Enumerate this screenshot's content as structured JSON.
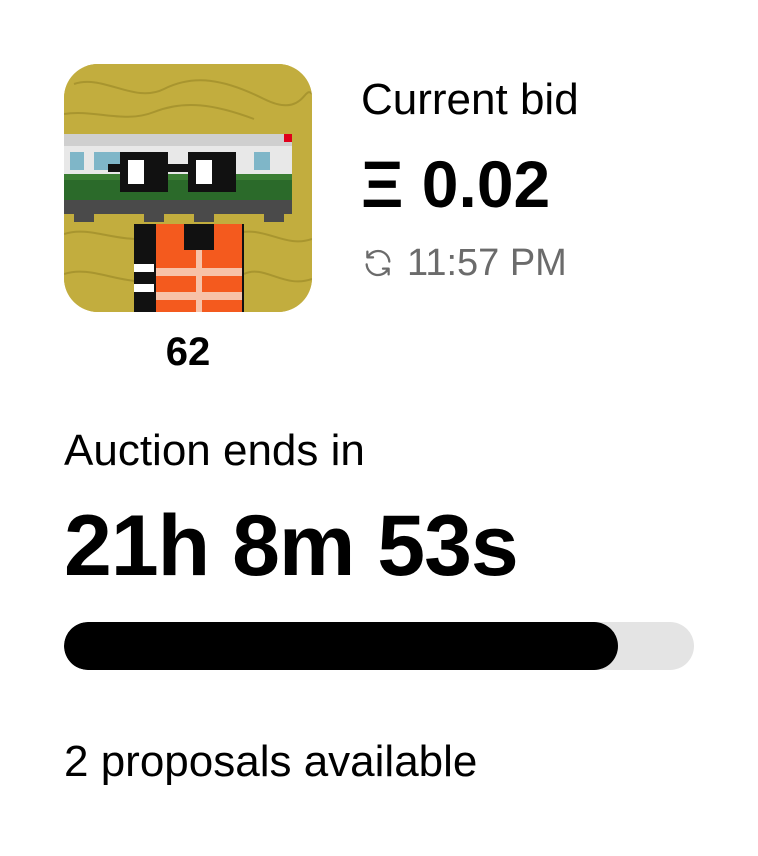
{
  "auction": {
    "token_id": "62",
    "current_bid_label": "Current bid",
    "current_bid_value": "Ξ 0.02",
    "bid_time": "11:57 PM",
    "ends_label": "Auction ends in",
    "countdown": "21h 8m 53s",
    "progress_fraction": 0.88,
    "proposals_text": "2 proposals available"
  },
  "icons": {
    "refresh": "refresh-icon"
  },
  "colors": {
    "image_background": "#c2ad3e",
    "progress_fill": "#000000",
    "progress_track": "#e4e4e4",
    "muted_text": "#6b6b6b"
  }
}
